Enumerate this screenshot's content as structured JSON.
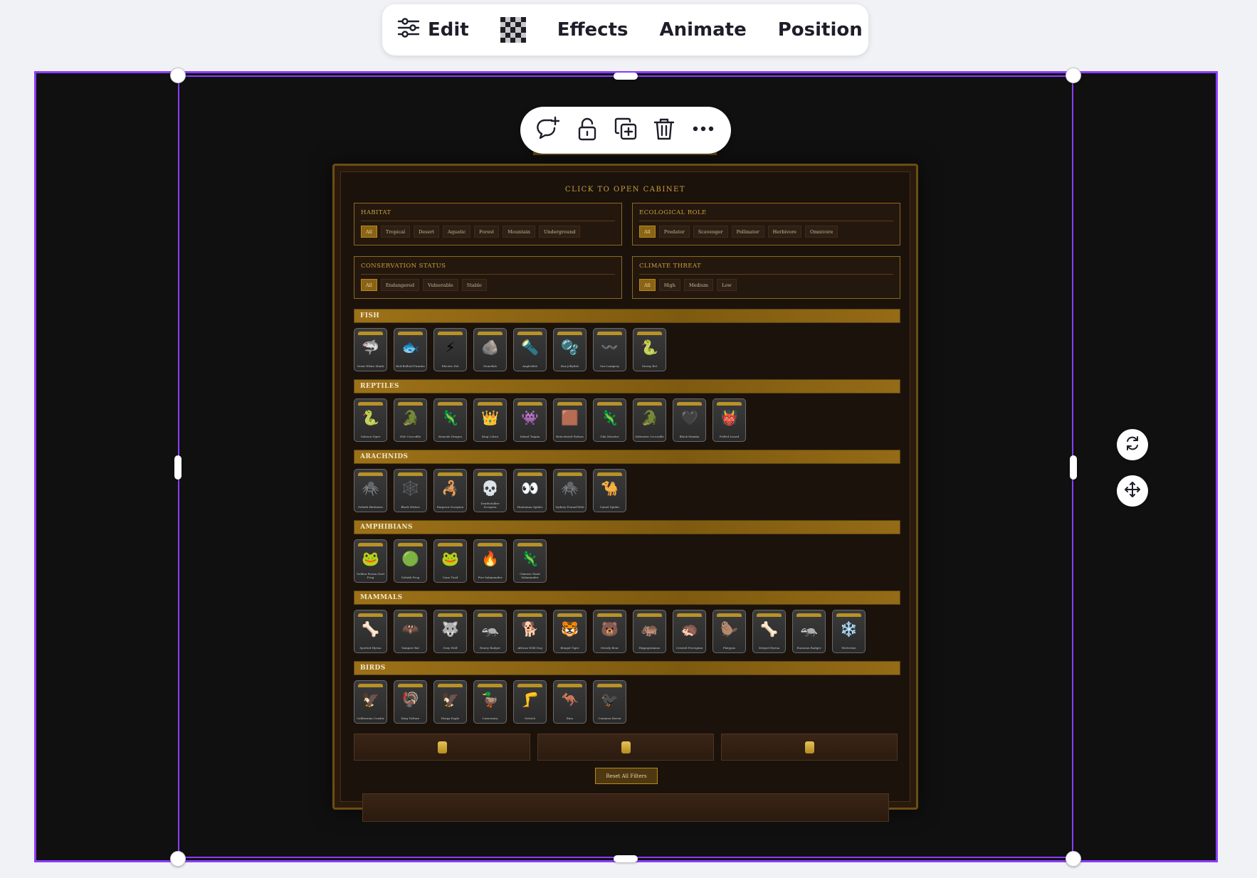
{
  "toolbar": {
    "edit_label": "Edit",
    "effects_label": "Effects",
    "animate_label": "Animate",
    "position_label": "Position"
  },
  "floating_actions": [
    "comment-add-icon",
    "unlock-icon",
    "duplicate-icon",
    "trash-icon",
    "more-icon"
  ],
  "side_actions": [
    "rotate-icon",
    "move-icon"
  ],
  "cabinet": {
    "title": "CLICK TO OPEN CABINET",
    "filters": [
      {
        "label": "HABITAT",
        "options": [
          "All",
          "Tropical",
          "Desert",
          "Aquatic",
          "Forest",
          "Mountain",
          "Underground"
        ],
        "active": 0
      },
      {
        "label": "ECOLOGICAL ROLE",
        "options": [
          "All",
          "Predator",
          "Scavenger",
          "Pollinator",
          "Herbivore",
          "Omnivore"
        ],
        "active": 0
      },
      {
        "label": "CONSERVATION STATUS",
        "options": [
          "All",
          "Endangered",
          "Vulnerable",
          "Stable"
        ],
        "active": 0
      },
      {
        "label": "CLIMATE THREAT",
        "options": [
          "All",
          "High",
          "Medium",
          "Low"
        ],
        "active": 0
      }
    ],
    "sections": [
      {
        "title": "FISH",
        "cards": [
          {
            "icon": "🦈",
            "name": "Great White Shark"
          },
          {
            "icon": "🐟",
            "name": "Red-Bellied Piranha"
          },
          {
            "icon": "⚡",
            "name": "Electric Eel"
          },
          {
            "icon": "🪨",
            "name": "Stonefish"
          },
          {
            "icon": "🔦",
            "name": "Anglerfish"
          },
          {
            "icon": "🫧",
            "name": "Box Jellyfish"
          },
          {
            "icon": "〰️",
            "name": "Sea Lamprey"
          },
          {
            "icon": "🐍",
            "name": "Moray Eel"
          }
        ]
      },
      {
        "title": "REPTILES",
        "cards": [
          {
            "icon": "🐍",
            "name": "Gaboon Viper"
          },
          {
            "icon": "🐊",
            "name": "Nile Crocodile"
          },
          {
            "icon": "🦎",
            "name": "Komodo Dragon"
          },
          {
            "icon": "👑",
            "name": "King Cobra"
          },
          {
            "icon": "👾",
            "name": "Inland Taipan"
          },
          {
            "icon": "🟫",
            "name": "Reticulated Python"
          },
          {
            "icon": "🦎",
            "name": "Gila Monster"
          },
          {
            "icon": "🐊",
            "name": "Saltwater Crocodile"
          },
          {
            "icon": "🖤",
            "name": "Black Mamba"
          },
          {
            "icon": "👹",
            "name": "Frilled Lizard"
          }
        ]
      },
      {
        "title": "ARACHNIDS",
        "cards": [
          {
            "icon": "🕷️",
            "name": "Goliath Birdeater"
          },
          {
            "icon": "🕸️",
            "name": "Black Widow"
          },
          {
            "icon": "🦂",
            "name": "Emperor Scorpion"
          },
          {
            "icon": "💀",
            "name": "Deathstalker Scorpion"
          },
          {
            "icon": "👀",
            "name": "Huntsman Spider"
          },
          {
            "icon": "🕷️",
            "name": "Sydney Funnel-Web"
          },
          {
            "icon": "🐪",
            "name": "Camel Spider"
          }
        ]
      },
      {
        "title": "AMPHIBIANS",
        "cards": [
          {
            "icon": "🐸",
            "name": "Golden Poison Dart Frog"
          },
          {
            "icon": "🟢",
            "name": "Goliath Frog"
          },
          {
            "icon": "🐸",
            "name": "Cane Toad"
          },
          {
            "icon": "🔥",
            "name": "Fire Salamander"
          },
          {
            "icon": "🦎",
            "name": "Chinese Giant Salamander"
          }
        ]
      },
      {
        "title": "MAMMALS",
        "cards": [
          {
            "icon": "🦴",
            "name": "Spotted Hyena"
          },
          {
            "icon": "🦇",
            "name": "Vampire Bat"
          },
          {
            "icon": "🐺",
            "name": "Gray Wolf"
          },
          {
            "icon": "🦡",
            "name": "Honey Badger"
          },
          {
            "icon": "🐕",
            "name": "African Wild Dog"
          },
          {
            "icon": "🐯",
            "name": "Bengal Tiger"
          },
          {
            "icon": "🐻",
            "name": "Grizzly Bear"
          },
          {
            "icon": "🦛",
            "name": "Hippopotamus"
          },
          {
            "icon": "🦔",
            "name": "Crested Porcupine"
          },
          {
            "icon": "🦫",
            "name": "Platypus"
          },
          {
            "icon": "🦴",
            "name": "Striped Hyena"
          },
          {
            "icon": "🦡",
            "name": "Eurasian Badger"
          },
          {
            "icon": "❄️",
            "name": "Wolverine"
          }
        ]
      },
      {
        "title": "BIRDS",
        "cards": [
          {
            "icon": "🦅",
            "name": "Californian Condor"
          },
          {
            "icon": "🦃",
            "name": "King Vulture"
          },
          {
            "icon": "🦅",
            "name": "Harpy Eagle"
          },
          {
            "icon": "🦆",
            "name": "Cassowary"
          },
          {
            "icon": "🦵",
            "name": "Ostrich"
          },
          {
            "icon": "🦘",
            "name": "Emu"
          },
          {
            "icon": "🐦‍⬛",
            "name": "Common Raven"
          }
        ]
      }
    ],
    "reset_label": "Reset All Filters"
  },
  "colors": {
    "selection": "#8b3dff",
    "accent_gold": "#c9a13a",
    "cabinet_bg": "#1b120c"
  }
}
